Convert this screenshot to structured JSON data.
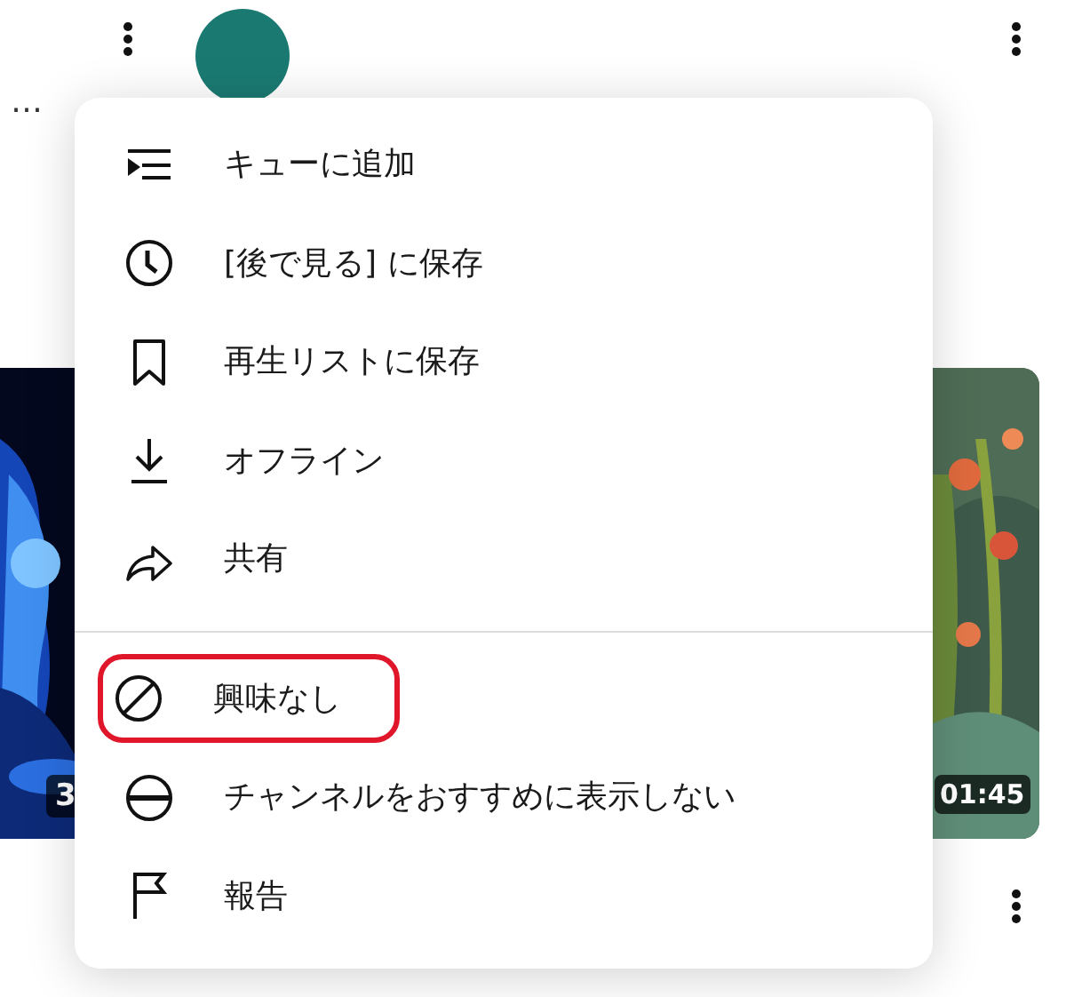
{
  "background": {
    "more_text": "…",
    "thumbnails": [
      {
        "duration": "3"
      },
      {
        "duration": "01:45"
      }
    ]
  },
  "menu": {
    "sections": [
      {
        "items": [
          {
            "label": "キューに追加",
            "annotated": false
          },
          {
            "label": "[後で見る] に保存",
            "annotated": false
          },
          {
            "label": "再生リストに保存",
            "annotated": false
          },
          {
            "label": "オフライン",
            "annotated": false
          },
          {
            "label": "共有",
            "annotated": false
          }
        ]
      },
      {
        "items": [
          {
            "label": "興味なし",
            "annotated": true
          },
          {
            "label": "チャンネルをおすすめに表示しない",
            "annotated": false
          },
          {
            "label": "報告",
            "annotated": false
          }
        ]
      }
    ]
  }
}
